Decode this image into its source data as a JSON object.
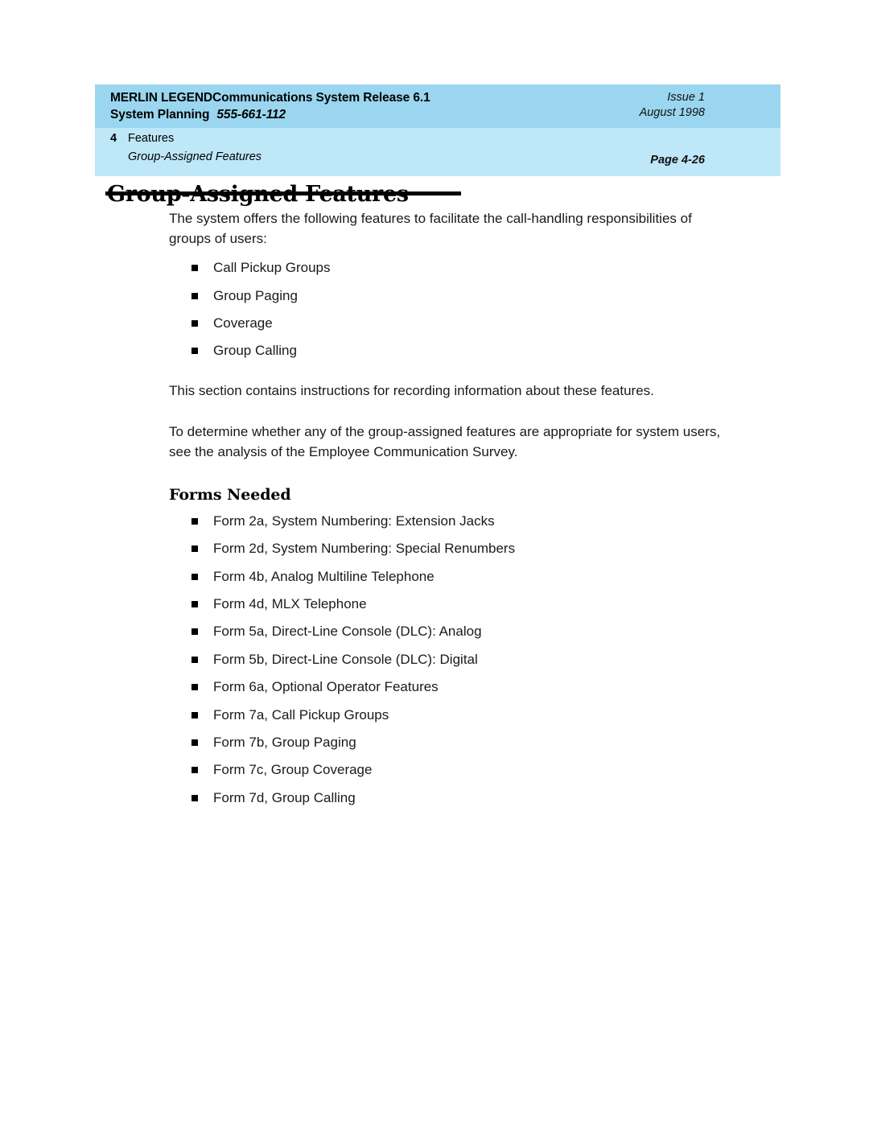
{
  "header": {
    "product_line": "MERLIN LEGENDCommunications System Release 6.1",
    "manual_title": "System Planning",
    "document_number": "555-661-112",
    "issue": "Issue 1",
    "date": "August 1998",
    "chapter_number": "4",
    "chapter_name": "Features",
    "section_name": "Group-Assigned Features",
    "page_number": "Page 4-26"
  },
  "main": {
    "title": "Group-Assigned Features",
    "intro_paragraph": "The system offers the following features to facilitate the call-handling responsibilities of groups of users:",
    "feature_list": [
      "Call Pickup Groups",
      "Group Paging",
      "Coverage",
      "Group Calling"
    ],
    "paragraph_2": "This section contains instructions for recording information about these features.",
    "paragraph_3": "To determine whether any of the group-assigned features are appropriate for system users, see the analysis of the Employee Communication Survey.",
    "forms_heading": "Forms Needed",
    "forms_list": [
      "Form 2a, System Numbering: Extension Jacks",
      "Form 2d, System Numbering: Special Renumbers",
      "Form 4b, Analog Multiline Telephone",
      "Form 4d, MLX Telephone",
      "Form 5a, Direct-Line Console (DLC): Analog",
      "Form 5b, Direct-Line Console (DLC): Digital",
      "Form 6a, Optional Operator Features",
      "Form 7a, Call Pickup Groups",
      "Form 7b, Group Paging",
      "Form 7c, Group Coverage",
      "Form 7d, Group Calling"
    ]
  },
  "colors": {
    "header_band_top": "#9ad6ef",
    "header_band_bottom": "#bee7f8",
    "page_background": "#ffffff",
    "text": "#000000"
  }
}
